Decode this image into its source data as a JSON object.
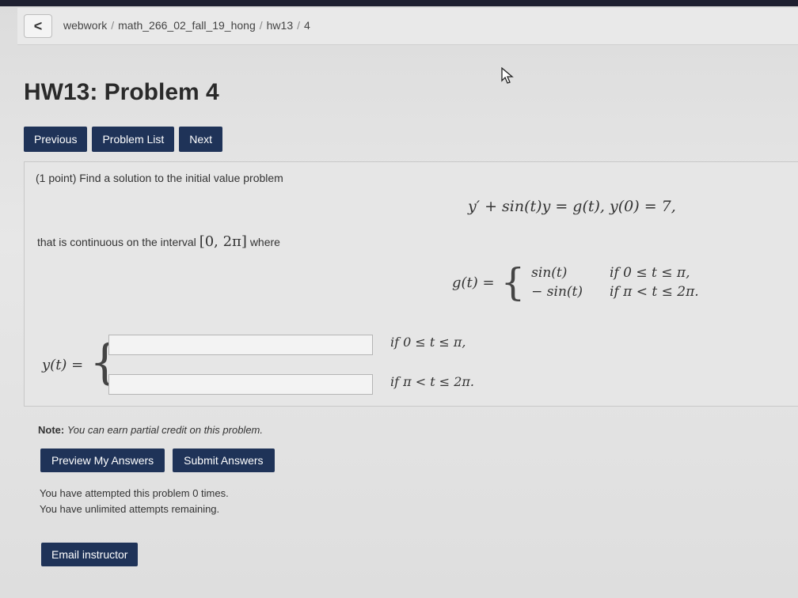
{
  "breadcrumb": {
    "back_label": "<",
    "items": [
      "webwork",
      "math_266_02_fall_19_hong",
      "hw13",
      "4"
    ]
  },
  "title": "HW13: Problem 4",
  "nav": {
    "previous": "Previous",
    "problem_list": "Problem List",
    "next": "Next"
  },
  "problem": {
    "intro": "(1 point) Find a solution to the initial value problem",
    "equation": "y′ + sin(t)y = g(t),   y(0) = 7,",
    "continuity_prefix": "that is continuous on the interval",
    "interval": "[0, 2π]",
    "continuity_suffix": "where",
    "g_label": "g(t) =",
    "g_cases": [
      {
        "expr": "sin(t)",
        "cond": "if 0 ≤ t ≤ π,"
      },
      {
        "expr": "− sin(t)",
        "cond": "if π < t ≤ 2π."
      }
    ],
    "y_label": "y(t) =",
    "answers": [
      {
        "value": "",
        "cond": "if 0 ≤ t ≤ π,"
      },
      {
        "value": "",
        "cond": "if π < t ≤ 2π."
      }
    ]
  },
  "note": {
    "label": "Note:",
    "text": "You can earn partial credit on this problem."
  },
  "actions": {
    "preview": "Preview My Answers",
    "submit": "Submit Answers"
  },
  "attempts": {
    "line1": "You have attempted this problem 0 times.",
    "line2": "You have unlimited attempts remaining."
  },
  "email": "Email instructor",
  "colors": {
    "button": "#1f3358",
    "topbar": "#1e2030"
  },
  "icons": {
    "back": "chevron-left-icon",
    "cursor": "mouse-pointer-icon"
  }
}
